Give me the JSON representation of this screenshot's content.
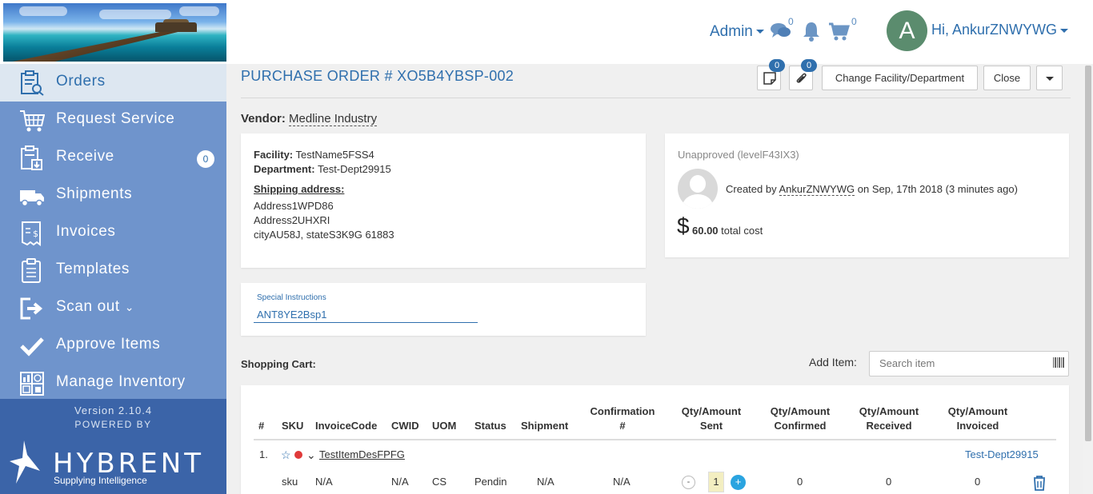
{
  "header": {
    "admin_label": "Admin",
    "messages_count": "0",
    "cart_count": "0",
    "avatar_letter": "A",
    "user_greeting": "Hi, AnkurZNWYWG"
  },
  "sidebar": {
    "items": [
      {
        "label": "Orders",
        "icon": "orders-icon"
      },
      {
        "label": "Request Service",
        "icon": "request-service-icon"
      },
      {
        "label": "Receive",
        "icon": "receive-icon",
        "badge": "0"
      },
      {
        "label": "Shipments",
        "icon": "truck-icon"
      },
      {
        "label": "Invoices",
        "icon": "invoice-icon"
      },
      {
        "label": "Templates",
        "icon": "clipboard-icon"
      },
      {
        "label": "Scan out",
        "icon": "scan-out-icon"
      },
      {
        "label": "Approve Items",
        "icon": "checkmark-icon"
      },
      {
        "label": "Manage Inventory",
        "icon": "inventory-icon"
      }
    ],
    "version": "Version 2.10.4",
    "powered_by": "POWERED BY",
    "brand": "HYBRENT",
    "brand_tagline": "Supplying Intelligence"
  },
  "order": {
    "title": "PURCHASE ORDER # XO5B4YBSP-002",
    "notes_badge": "0",
    "attachments_badge": "0",
    "change_facility_label": "Change Facility/Department",
    "close_label": "Close",
    "vendor_label": "Vendor:",
    "vendor_name": "Medline Industry",
    "facility_label": "Facility:",
    "facility": "TestName5FSS4",
    "department_label": "Department:",
    "department": "Test-Dept29915",
    "shipping_label": "Shipping address:",
    "address1": "Address1WPD86",
    "address2": "Address2UHXRI",
    "city_line": "cityAU58J, stateS3K9G 61883",
    "approval_status": "Unapproved (levelF43IX3)",
    "created_by_prefix": "Created by",
    "created_by_user": "AnkurZNWYWG",
    "created_on": "on Sep, 17th 2018 (3 minutes ago)",
    "currency_symbol": "$",
    "total_cost": "60.00",
    "total_cost_suffix": "total cost",
    "special_instructions_label": "Special Instructions",
    "special_instructions_value": "ANT8YE2Bsp1"
  },
  "cart": {
    "label": "Shopping Cart:",
    "add_item_label": "Add Item:",
    "search_placeholder": "Search item",
    "columns": {
      "num": "#",
      "sku": "SKU",
      "invoice_code": "InvoiceCode",
      "cwid": "CWID",
      "uom": "UOM",
      "status": "Status",
      "shipment": "Shipment",
      "confirmation_1": "Confirmation",
      "confirmation_2": "#",
      "sent_1": "Qty/Amount",
      "sent_2": "Sent",
      "confirmed_1": "Qty/Amount",
      "confirmed_2": "Confirmed",
      "received_1": "Qty/Amount",
      "received_2": "Received",
      "invoiced_1": "Qty/Amount",
      "invoiced_2": "Invoiced"
    },
    "rows": [
      {
        "num": "1.",
        "item_name": "TestItemDesFPFG",
        "department": "Test-Dept29915",
        "sku": "sku",
        "invoice_code": "N/A",
        "cwid": "N/A",
        "uom": "CS",
        "status": "Pendin",
        "shipment": "N/A",
        "confirmation": "N/A",
        "qty_minus": "-",
        "qty_sent": "1",
        "qty_plus": "+",
        "qty_confirmed": "0",
        "qty_received": "0",
        "qty_invoiced": "0"
      }
    ]
  },
  "colors": {
    "accent": "#2f6fad",
    "sidebar": "#6f94cc",
    "sidebar_footer": "#3b64a8",
    "active_nav": "#dde7f1"
  }
}
